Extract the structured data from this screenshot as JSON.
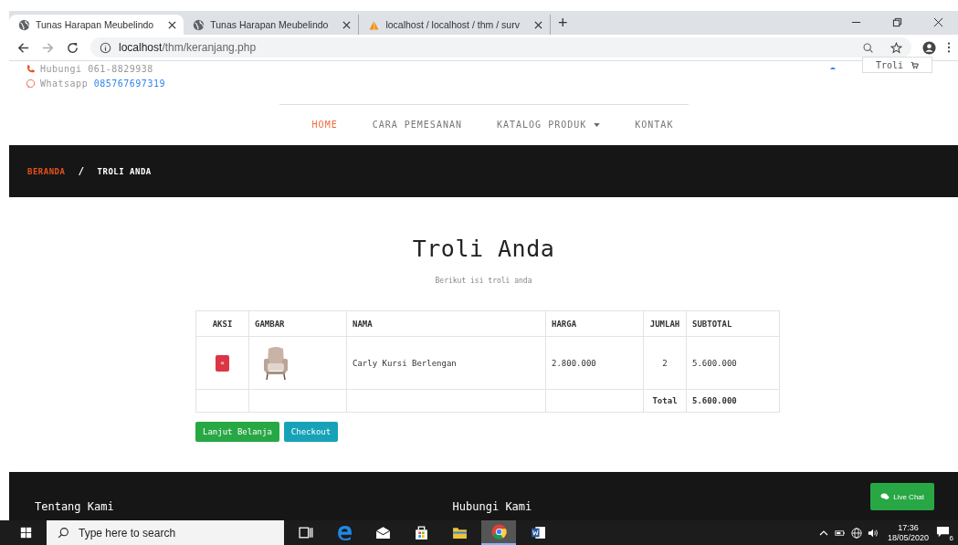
{
  "browser": {
    "tabs": [
      {
        "title": "Tunas Harapan Meubelindo",
        "kind": "website",
        "selected": true
      },
      {
        "title": "Tunas Harapan Meubelindo",
        "kind": "website",
        "selected": false
      },
      {
        "title": "localhost / localhost / thm / surv",
        "kind": "database",
        "selected": false
      }
    ],
    "new_tab": "+",
    "address": {
      "host": "localhost",
      "path": "/thm/keranjang.php"
    }
  },
  "topbar": {
    "phone": {
      "label": "Hubungi",
      "number": "061-8829938"
    },
    "whatsapp": {
      "label": "Whatsapp",
      "number": "085767697319"
    },
    "cart_button": "Troli"
  },
  "nav": [
    {
      "label": "HOME",
      "selected": true,
      "dropdown": false
    },
    {
      "label": "CARA PEMESANAN",
      "selected": false,
      "dropdown": false
    },
    {
      "label": "KATALOG PRODUK",
      "selected": false,
      "dropdown": true
    },
    {
      "label": "KONTAK",
      "selected": false,
      "dropdown": false
    }
  ],
  "breadcrumb": {
    "items": [
      {
        "label": "BERANDA",
        "kind": "link"
      },
      {
        "label": "TROLI ANDA",
        "kind": "current"
      }
    ],
    "separator": "/"
  },
  "heading": "Troli Anda",
  "subheading": "Berikut isi troli anda",
  "table": {
    "columns": [
      "AKSI",
      "GAMBAR",
      "NAMA",
      "HARGA",
      "JUMLAH",
      "SUBTOTAL"
    ],
    "rows": [
      {
        "action": "×",
        "name": "Carly Kursi Berlengan",
        "price": "2.800.000",
        "qty": "2",
        "subtotal": "5.600.000"
      }
    ],
    "total": {
      "label": "Total",
      "value": "5.600.000"
    }
  },
  "buttons": [
    {
      "label": "Lanjut Belanja",
      "kind": "success"
    },
    {
      "label": "Checkout",
      "kind": "info"
    }
  ],
  "footer": {
    "columns": [
      "Tentang Kami",
      "Hubungi Kami"
    ],
    "live_chat": "Live Chat"
  },
  "taskbar": {
    "search_placeholder": "Type here to search",
    "time": "17:36",
    "date": "18/05/2020",
    "notifications": "6"
  }
}
